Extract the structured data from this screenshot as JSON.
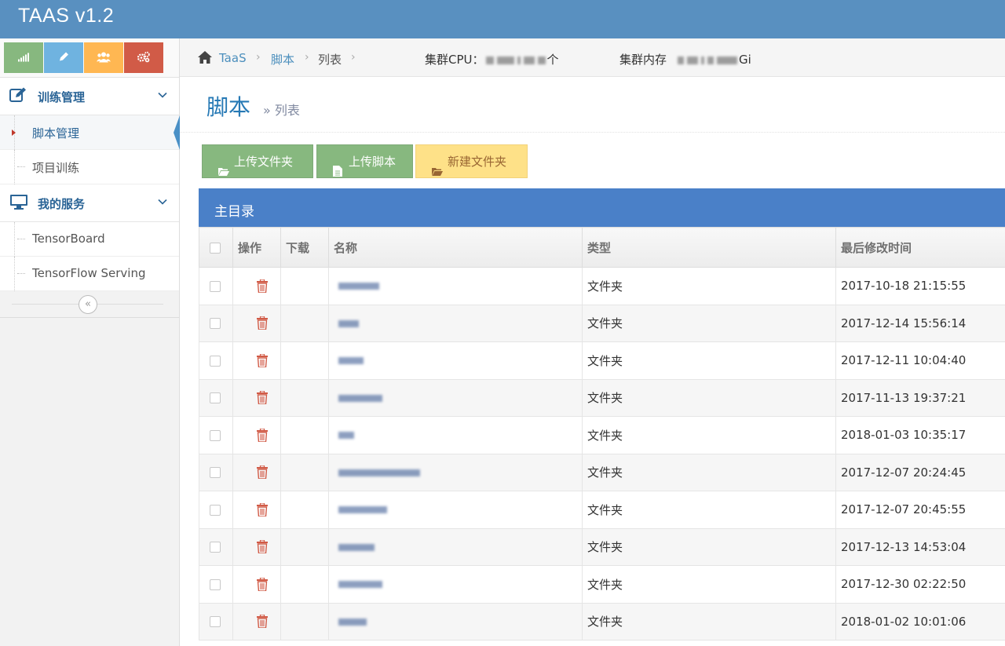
{
  "app": {
    "title": "TAAS v1.2"
  },
  "shortcuts": [
    {
      "icon": "signal-icon",
      "color": "#87b87f"
    },
    {
      "icon": "pencil-icon",
      "color": "#6fb3e0"
    },
    {
      "icon": "users-icon",
      "color": "#ffb752"
    },
    {
      "icon": "cogs-icon",
      "color": "#d15b47"
    }
  ],
  "sidebar": {
    "groups": [
      {
        "label": "训练管理",
        "icon": "edit-icon",
        "items": [
          {
            "label": "脚本管理",
            "active": true
          },
          {
            "label": "项目训练",
            "active": false
          }
        ]
      },
      {
        "label": "我的服务",
        "icon": "desktop-icon",
        "items": [
          {
            "label": "TensorBoard",
            "active": false
          },
          {
            "label": "TensorFlow Serving",
            "active": false
          }
        ]
      }
    ],
    "collapse_glyph": "«"
  },
  "breadcrumb": {
    "items": [
      "TaaS",
      "脚本",
      "列表"
    ],
    "separator": "›",
    "cpu_label": "集群CPU：",
    "cpu_unit": "个",
    "mem_label": "集群内存",
    "mem_unit": "Gi"
  },
  "page": {
    "title": "脚本",
    "subtitle": "» 列表"
  },
  "toolbar": {
    "upload_folder": "上传文件夹",
    "upload_script": "上传脚本",
    "new_folder": "新建文件夹"
  },
  "panel": {
    "title": "主目录"
  },
  "table": {
    "headers": {
      "action": "操作",
      "download": "下载",
      "name": "名称",
      "type": "类型",
      "modified": "最后修改时间"
    },
    "rows": [
      {
        "type": "文件夹",
        "modified": "2017-10-18 21:15:55"
      },
      {
        "type": "文件夹",
        "modified": "2017-12-14 15:56:14"
      },
      {
        "type": "文件夹",
        "modified": "2017-12-11 10:04:40"
      },
      {
        "type": "文件夹",
        "modified": "2017-11-13 19:37:21"
      },
      {
        "type": "文件夹",
        "modified": "2018-01-03 10:35:17"
      },
      {
        "type": "文件夹",
        "modified": "2017-12-07 20:24:45"
      },
      {
        "type": "文件夹",
        "modified": "2017-12-07 20:45:55"
      },
      {
        "type": "文件夹",
        "modified": "2017-12-13 14:53:04"
      },
      {
        "type": "文件夹",
        "modified": "2017-12-30 02:22:50"
      },
      {
        "type": "文件夹",
        "modified": "2018-01-02 10:01:06"
      }
    ]
  },
  "colors": {
    "navbar": "#5990c0",
    "link": "#2a6496",
    "table_header": "#4a80c8",
    "danger": "#d15b47"
  }
}
